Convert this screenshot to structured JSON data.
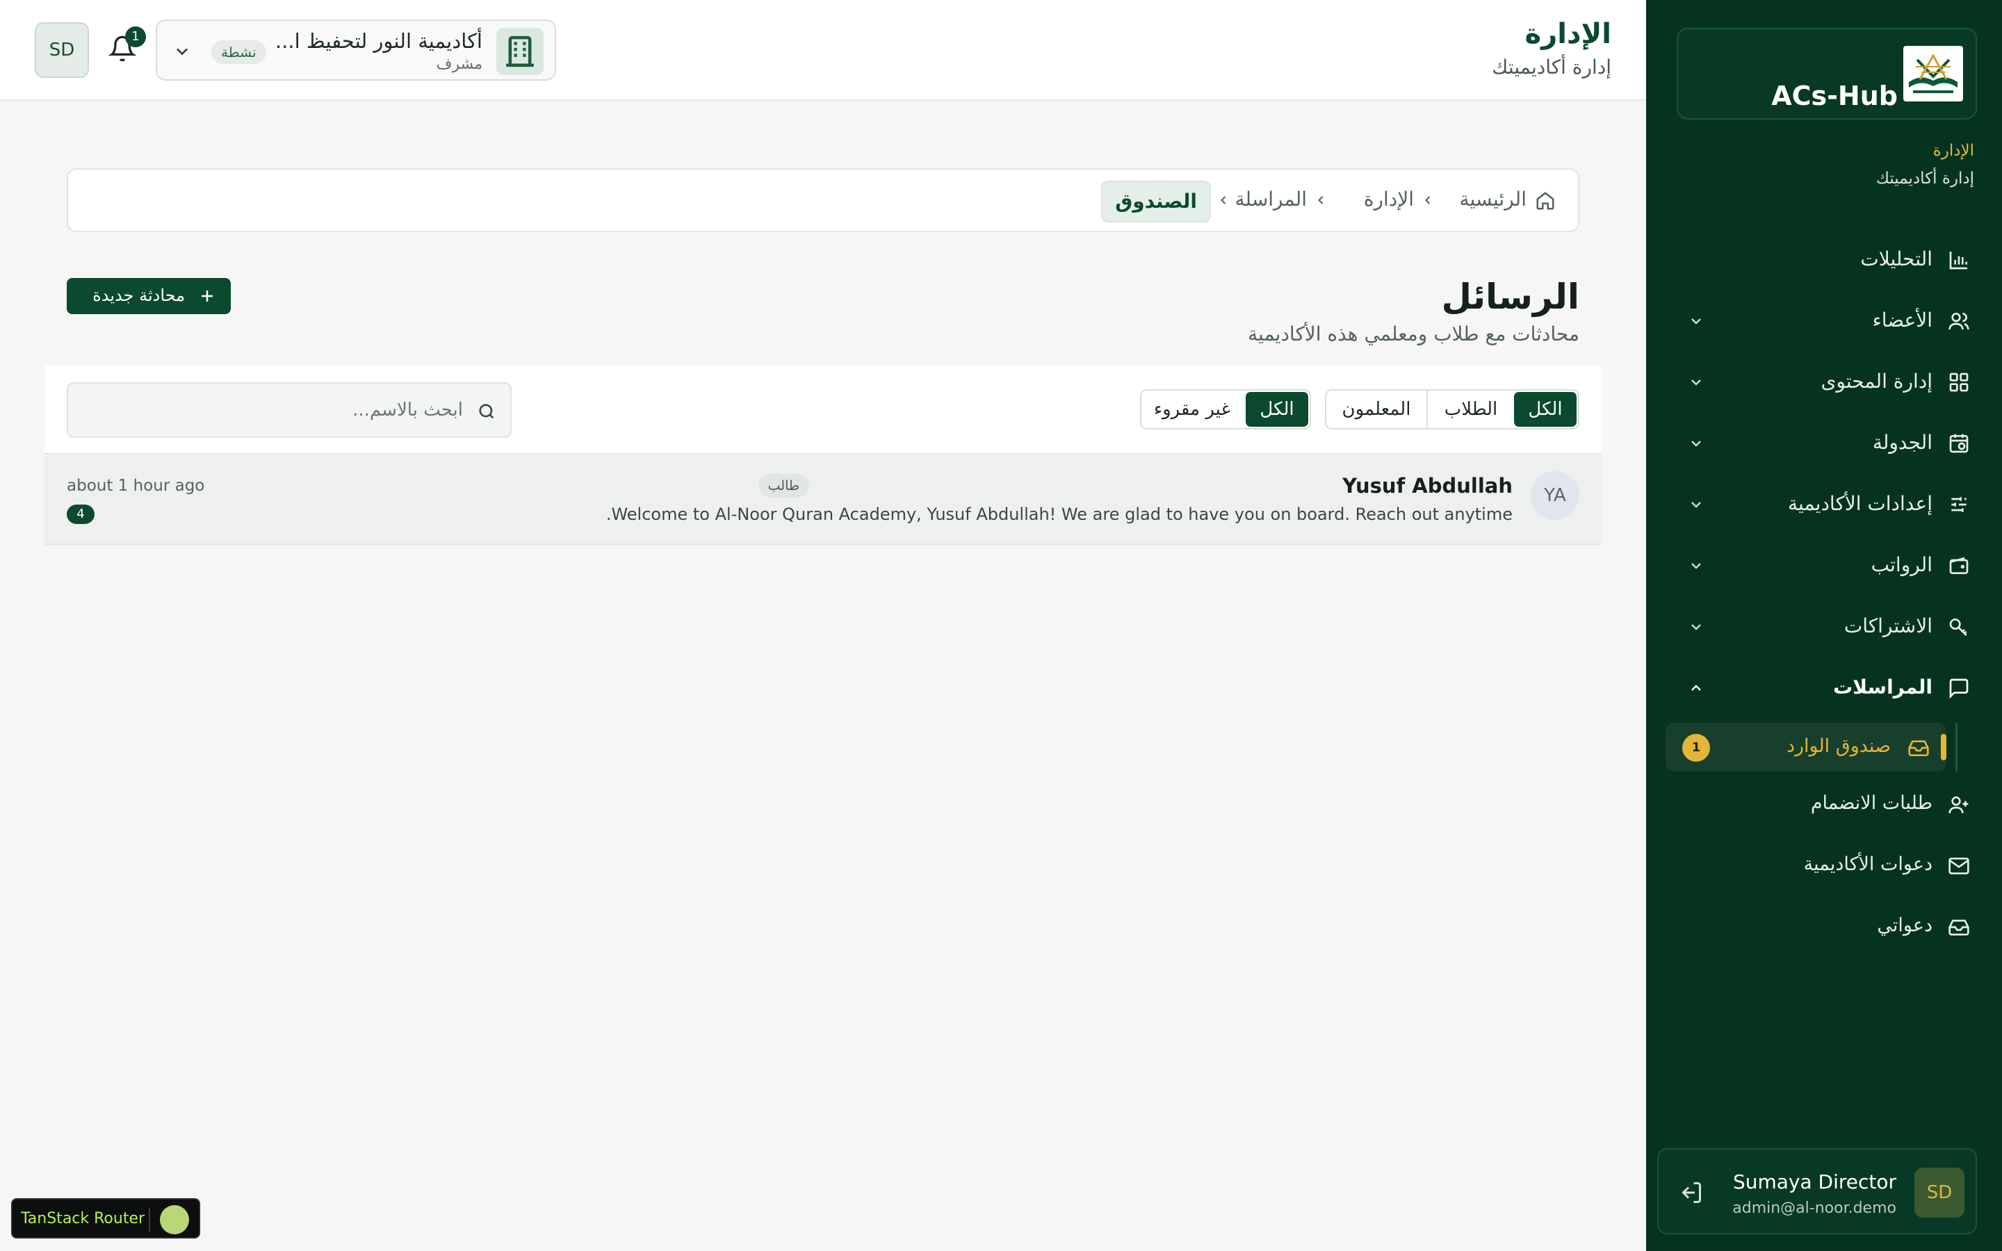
{
  "app": {
    "brand": "ACs-Hub"
  },
  "sidebar": {
    "section_title": "الإدارة",
    "section_sub": "إدارة أكاديميتك",
    "items": [
      {
        "label": "التحليلات",
        "icon": "chart-bar-icon"
      },
      {
        "label": "الأعضاء",
        "icon": "users-icon"
      },
      {
        "label": "إدارة المحتوى",
        "icon": "grid-icon"
      },
      {
        "label": "الجدولة",
        "icon": "calendar-clock-icon"
      },
      {
        "label": "إعدادات الأكاديمية",
        "icon": "sliders-icon"
      },
      {
        "label": "الرواتب",
        "icon": "wallet-icon"
      },
      {
        "label": "الاشتراكات",
        "icon": "subscriptions-icon"
      },
      {
        "label": "المراسلات",
        "icon": "message-square-icon"
      }
    ],
    "sub_items": [
      {
        "label": "صندوق الوارد",
        "icon": "inbox-icon",
        "badge": "1"
      },
      {
        "label": "طلبات الانضمام",
        "icon": "user-plus-icon"
      },
      {
        "label": "دعوات الأكاديمية",
        "icon": "mail-icon"
      },
      {
        "label": "دعواتي",
        "icon": "inbox-tray-icon"
      }
    ],
    "user": {
      "initials": "SD",
      "name": "Sumaya Director",
      "email": "admin@al-noor.demo"
    }
  },
  "header": {
    "title": "الإدارة",
    "subtitle": "إدارة أكاديميتك",
    "academy": {
      "name": "أكاديمية النور لتحفيظ ا...",
      "role": "مشرف",
      "status": "نشطة"
    },
    "notifications_count": "1",
    "avatar_initials": "SD"
  },
  "breadcrumb": [
    "الرئيسية",
    "الإدارة",
    "المراسلة",
    "الصندوق"
  ],
  "page": {
    "title": "الرسائل",
    "subtitle": "محادثات مع طلاب ومعلمي هذه الأكاديمية",
    "new_button": "محادثة جديدة"
  },
  "filters": {
    "audience": [
      "الكل",
      "الطلاب",
      "المعلمون"
    ],
    "read_state": [
      "الكل",
      "غير مقروء"
    ],
    "search_placeholder": "ابحث بالاسم..."
  },
  "conversations": [
    {
      "initials": "YA",
      "name": "Yusuf Abdullah",
      "role": "طالب",
      "preview": "Welcome to Al-Noor Quran Academy, Yusuf Abdullah! We are glad to have you on board. Reach out anytime.",
      "time": "about 1 hour ago",
      "unread": "4"
    }
  ],
  "devtools": {
    "label": "TanStack Router"
  },
  "colors": {
    "sidebar_bg": "#06331f",
    "primary": "#0b4a2f",
    "accent": "#e2b53b"
  }
}
